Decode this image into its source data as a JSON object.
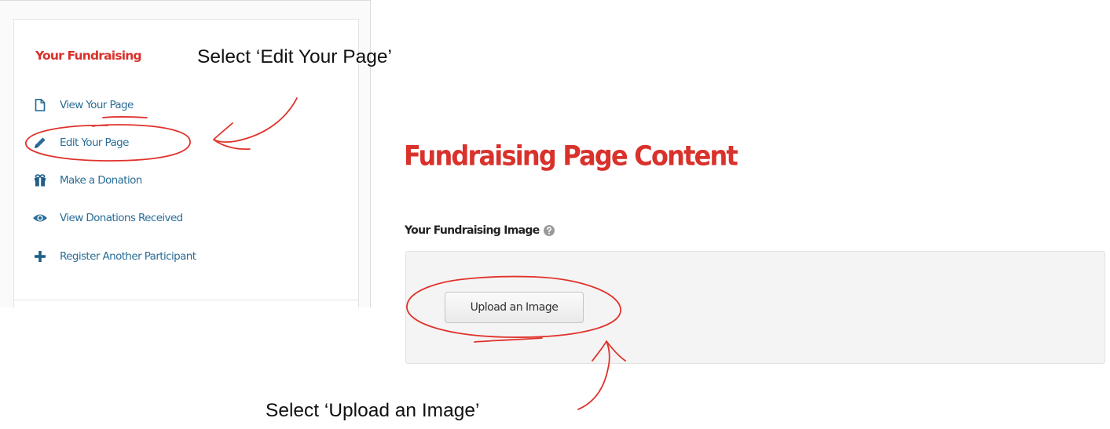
{
  "sidebar": {
    "heading": "Your Fundraising",
    "items": [
      {
        "label": "View Your Page",
        "icon": "page-icon"
      },
      {
        "label": "Edit Your Page",
        "icon": "pencil-icon"
      },
      {
        "label": "Make a Donation",
        "icon": "gift-icon"
      },
      {
        "label": "View Donations Received",
        "icon": "eye-icon"
      },
      {
        "label": "Register Another Participant",
        "icon": "plus-icon"
      }
    ]
  },
  "main": {
    "title": "Fundraising Page Content",
    "image_field_label": "Your Fundraising Image",
    "upload_button_label": "Upload an Image"
  },
  "annotations": {
    "callout_edit": "Select ‘Edit Your Page’",
    "callout_upload": "Select ‘Upload an Image’"
  },
  "colors": {
    "accent_red": "#d9312b",
    "link_blue": "#2a6d97",
    "annotation_red": "#e0322b"
  }
}
